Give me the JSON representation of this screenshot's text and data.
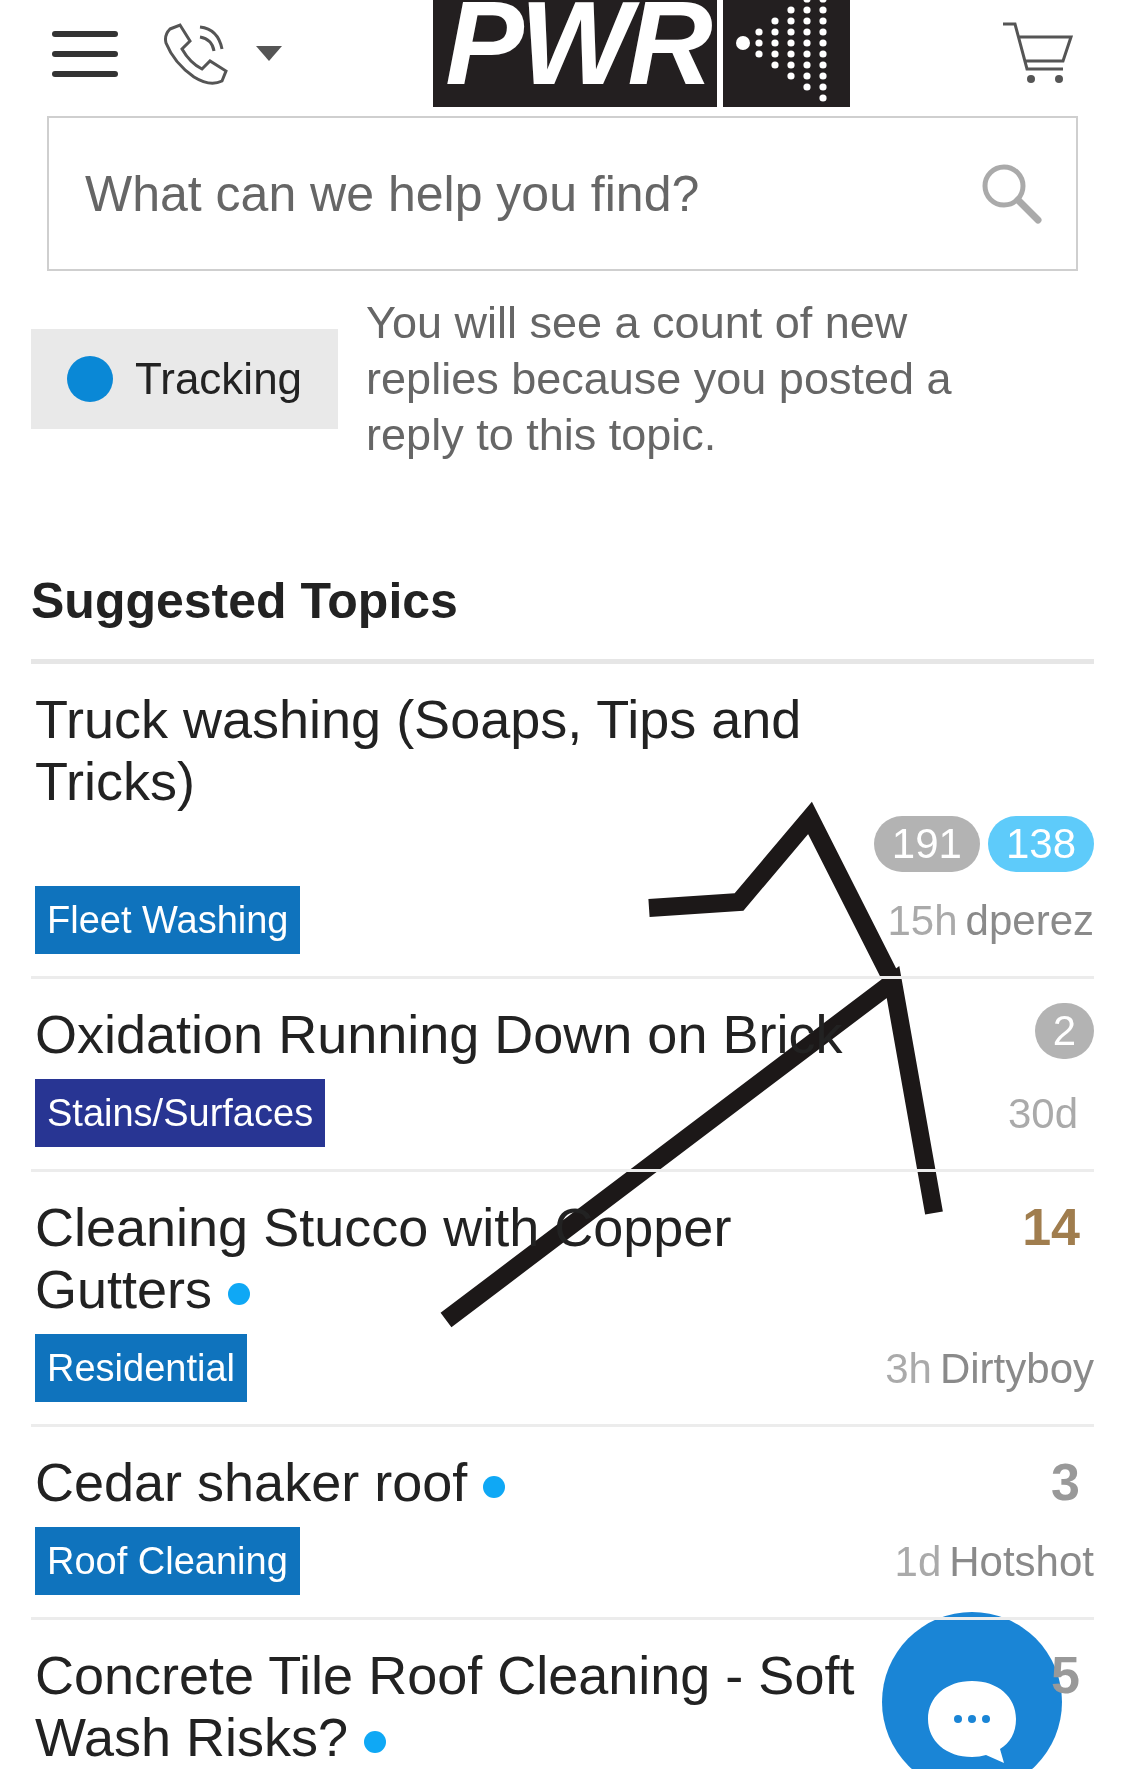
{
  "header": {
    "logo_text": "PWR"
  },
  "search": {
    "placeholder": "What can we help you find?"
  },
  "notification": {
    "label": "Tracking",
    "color": "#0a88d6",
    "description": "You will see a count of new replies because you posted a reply to this topic."
  },
  "suggested": {
    "heading": "Suggested Topics",
    "topics": [
      {
        "title": "Truck washing (Soaps, Tips and Tricks)",
        "unread": false,
        "counts": [
          {
            "text": "191",
            "kind": "pill",
            "color": "#b3b3b3"
          },
          {
            "text": "138",
            "kind": "pill",
            "color": "#5ecbfa"
          }
        ],
        "category": {
          "name": "Fleet Washing",
          "color": "#0f73bd"
        },
        "age": "15h",
        "user": "dperez"
      },
      {
        "title": "Oxidation Running Down on Brick",
        "unread": false,
        "counts": [
          {
            "text": "2",
            "kind": "pill",
            "color": "#b3b3b3"
          }
        ],
        "category": {
          "name": "Stains/Surfaces",
          "color": "#283593"
        },
        "age": "30d"
      },
      {
        "title": "Cleaning Stucco with Copper Gutters",
        "unread": true,
        "counts": [
          {
            "text": "14",
            "kind": "number",
            "color": "#a07d4e"
          }
        ],
        "category": {
          "name": "Residential",
          "color": "#0f73bd"
        },
        "age": "3h",
        "user": "Dirtyboy"
      },
      {
        "title": "Cedar shaker roof",
        "unread": true,
        "counts": [
          {
            "text": "3",
            "kind": "number",
            "color": "#999999"
          }
        ],
        "category": {
          "name": "Roof Cleaning",
          "color": "#0f73bd"
        },
        "age": "1d",
        "user": "Hotshot"
      },
      {
        "title": "Concrete Tile Roof Cleaning - Soft Wash Risks?",
        "unread": true,
        "counts": [
          {
            "text": "5",
            "kind": "number",
            "color": "#999999"
          }
        ]
      }
    ]
  }
}
